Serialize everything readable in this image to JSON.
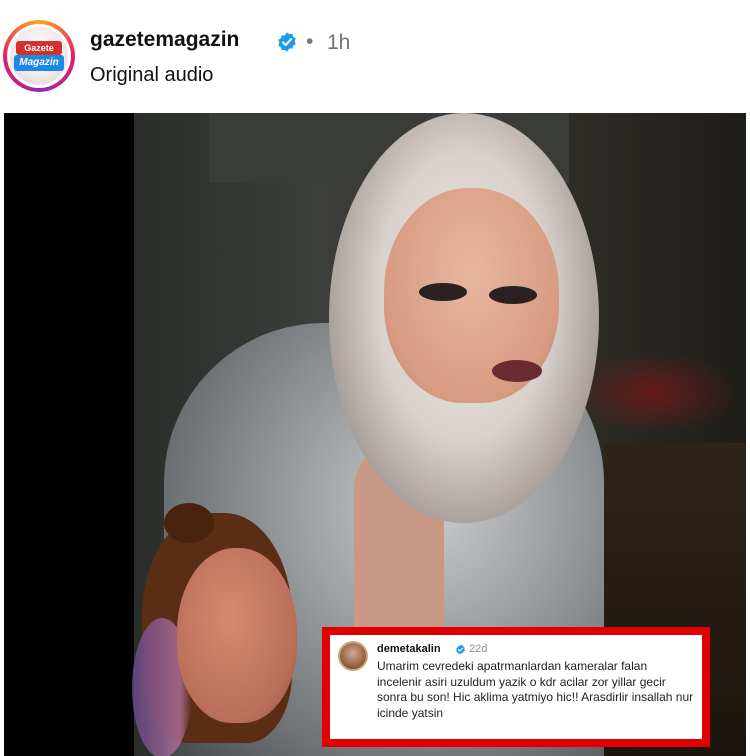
{
  "post": {
    "username": "gazetemagazin",
    "time": "1h",
    "dot": "•",
    "audio": "Original audio",
    "avatar_logo_top": "Gazete",
    "avatar_logo_bottom": "Magazin",
    "verified_color": "#1d9bf0"
  },
  "comment": {
    "username": "demetakalin",
    "time": "22d",
    "text": "Umarim cevredeki apatrmanlardan kameralar falan incelenir asiri uzuldum yazik o kdr acilar zor yillar gecir sonra bu son! Hic aklima yatmiyo hic!! Arasdirlir insallah nur icinde yatsin",
    "highlight_color": "#e00000"
  },
  "icons": {
    "verified": "verified-badge-icon"
  }
}
